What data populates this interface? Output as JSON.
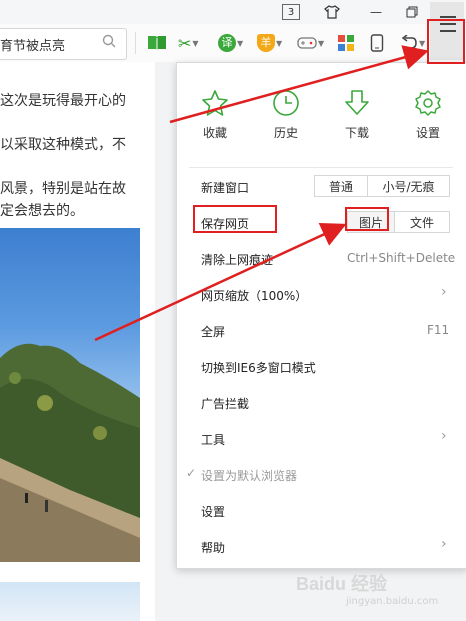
{
  "titlebar": {
    "window_count": "3",
    "minimize": "—",
    "close": "✕"
  },
  "toolbar": {
    "address_text": "育节被点亮",
    "search_icon": "magnifier-icon",
    "translate_label": "译",
    "shield_label": "羊"
  },
  "article": {
    "lines": [
      "这次是玩得最开心的",
      "以采取这种模式，不",
      "风景，特别是站在故",
      "定会想去的。"
    ]
  },
  "menu": {
    "quick": [
      {
        "label": "收藏",
        "icon": "star-icon"
      },
      {
        "label": "历史",
        "icon": "clock-icon"
      },
      {
        "label": "下载",
        "icon": "download-icon"
      },
      {
        "label": "设置",
        "icon": "gear-icon"
      }
    ],
    "new_window": "新建窗口",
    "new_window_normal": "普通",
    "new_window_incognito": "小号/无痕",
    "save_page": "保存网页",
    "save_image": "图片",
    "save_file": "文件",
    "clear_traces": "清除上网痕迹",
    "clear_shortcut": "Ctrl+Shift+Delete",
    "zoom": "网页缩放（100%）",
    "fullscreen": "全屏",
    "fullscreen_shortcut": "F11",
    "ie6_mode": "切换到IE6多窗口模式",
    "adblock": "广告拦截",
    "tools": "工具",
    "default_browser": "设置为默认浏览器",
    "settings": "设置",
    "help": "帮助"
  },
  "watermark": {
    "text": "Baidu 经验",
    "url": "jingyan.baidu.com"
  },
  "colors": {
    "accent_green": "#3aa83a",
    "annotation_red": "#e02020"
  }
}
